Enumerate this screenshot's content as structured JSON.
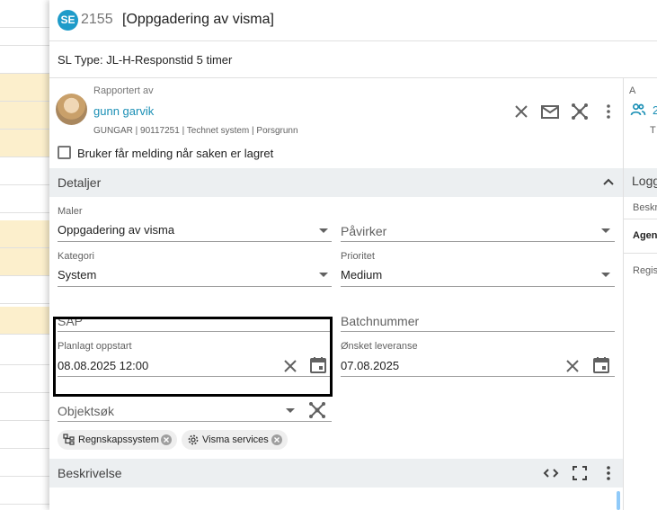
{
  "header": {
    "badge": "SE",
    "case_number": "2155",
    "title": "[Oppgadering av visma]"
  },
  "sl_type": "SL Type: JL-H-Responstid 5 timer",
  "reporter": {
    "label": "Rapportert av",
    "name": "gunn garvik",
    "meta": "GUNGAR | 90117251 | Technet system | Porsgrunn"
  },
  "notify_checkbox": {
    "label": "Bruker får melding når saken er lagret",
    "checked": false
  },
  "details": {
    "title": "Detaljer",
    "maler": {
      "label": "Maler",
      "value": "Oppgadering av visma"
    },
    "pavirker": {
      "placeholder": "Påvirker"
    },
    "kategori": {
      "label": "Kategori",
      "value": "System"
    },
    "prioritet": {
      "label": "Prioritet",
      "value": "Medium"
    },
    "sap": {
      "placeholder": "SAP"
    },
    "batch": {
      "placeholder": "Batchnummer"
    },
    "planlagt": {
      "label": "Planlagt oppstart",
      "value": "08.08.2025 12:00"
    },
    "onsket": {
      "label": "Ønsket leveranse",
      "value": "07.08.2025"
    },
    "objektsok": {
      "placeholder": "Objektsøk"
    },
    "chips": [
      {
        "label": "Regnskapssystem",
        "icon": "hierarchy-icon"
      },
      {
        "label": "Visma services",
        "icon": "gear-icon"
      }
    ]
  },
  "beskrivelse": {
    "title": "Beskrivelse"
  },
  "right_pane": {
    "assignee_initial": "A",
    "assignee_count": "2",
    "assignee_t": "T",
    "logg_title": "Logg",
    "beskrivelse_short": "Beskr",
    "agent_short": "Agent",
    "regist_short": "Regis"
  },
  "colors": {
    "accent": "#1e9bc9",
    "link": "#1a8fb5",
    "row_highlight": "#fcefcc",
    "section_bg": "#eceff1"
  }
}
